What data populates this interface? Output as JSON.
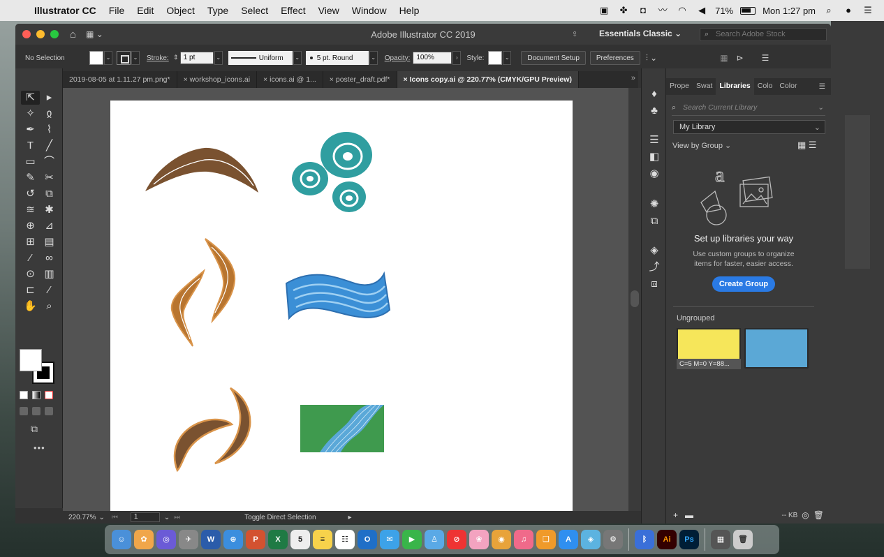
{
  "menubar": {
    "app": "Illustrator CC",
    "items": [
      "File",
      "Edit",
      "Object",
      "Type",
      "Select",
      "Effect",
      "View",
      "Window",
      "Help"
    ],
    "battery": "71%",
    "clock": "Mon 1:27 pm"
  },
  "window": {
    "title": "Adobe Illustrator CC 2019",
    "workspace": "Essentials Classic",
    "search_placeholder": "Search Adobe Stock"
  },
  "controlbar": {
    "selection": "No Selection",
    "stroke_label": "Stroke:",
    "stroke_value": "1 pt",
    "profile": "Uniform",
    "brush": "5 pt. Round",
    "opacity_label": "Opacity:",
    "opacity_value": "100%",
    "style_label": "Style:",
    "doc_setup": "Document Setup",
    "preferences": "Preferences"
  },
  "tabs": [
    {
      "label": "2019-08-05 at 1.11.27 pm.png*",
      "active": false
    },
    {
      "label": "workshop_icons.ai",
      "active": false
    },
    {
      "label": "icons.ai @ 1...",
      "active": false
    },
    {
      "label": "poster_draft.pdf*",
      "active": false
    },
    {
      "label": "Icons copy.ai @ 220.77% (CMYK/GPU Preview)",
      "active": true
    }
  ],
  "statusbar": {
    "zoom": "220.77%",
    "page": "1",
    "status": "Toggle Direct Selection"
  },
  "libraries": {
    "tabs": [
      "Prope",
      "Swat",
      "Libraries",
      "Colo",
      "Color"
    ],
    "active_tab": "Libraries",
    "search_placeholder": "Search Current Library",
    "library": "My Library",
    "view_by": "View by Group",
    "heading": "Set up libraries your way",
    "description": "Use custom groups to organize items for faster, easier access.",
    "create_button": "Create Group",
    "ungrouped": "Ungrouped",
    "asset1_label": "C=5 M=0 Y=88...",
    "footer_size": "-- KB"
  },
  "colors": {
    "boomerang_brown": "#7a5230",
    "boomerang_orange": "#c8842f",
    "teal": "#2f9ea0",
    "wave_blue": "#3b8fd6",
    "river_green": "#3f9a4e",
    "create_blue": "#2a7ae4",
    "asset_yellow": "#f6e65a",
    "asset_blue": "#5ba8d6"
  }
}
